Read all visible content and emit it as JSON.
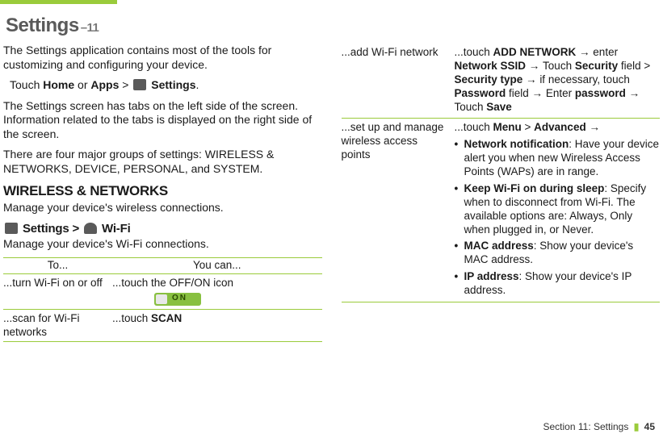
{
  "title_main": "Settings",
  "title_sub": "–11",
  "left": {
    "intro": "The Settings application contains most of the tools for customizing and configuring your device.",
    "touch_line_pre": "Touch ",
    "home": "Home",
    "or": " or ",
    "apps": "Apps",
    "gt": " > ",
    "settings_word": " Settings",
    "period": ".",
    "tabs_info": "The Settings screen has tabs on the left side of the screen. Information related to the tabs is displayed on the right side of the screen.",
    "groups_info": "There are four major groups of settings: WIRELESS & NETWORKS, DEVICE, PERSONAL, and SYSTEM.",
    "wireless_header": "WIRELESS & NETWORKS",
    "wireless_sub": "Manage your device's wireless connections.",
    "wifi_header_pre": " Settings > ",
    "wifi_header_post": " Wi-Fi",
    "wifi_sub": "Manage your device's Wi-Fi connections.",
    "th_to": "To...",
    "th_youcan": "You can...",
    "r1c1": "...turn Wi-Fi on or off",
    "r1c2": "...touch the OFF/ON icon",
    "r2c1": "...scan for Wi-Fi networks",
    "r2c2_pre": "...touch ",
    "r2c2_b": "SCAN"
  },
  "right": {
    "r1c1": "...add Wi-Fi network",
    "r1_pre": "...touch ",
    "add_network": "ADD NETWORK",
    "arrow": " → ",
    "enter": "enter ",
    "network_ssid": "Network SSID",
    "touch": " Touch ",
    "security": "Security",
    "field_gt": " field > ",
    "security_type": "Security type",
    "if_nec": " if necessary, touch ",
    "password": "Password",
    "field_arrow": " field → ",
    "enter2": "Enter ",
    "password2": "password",
    "touch2": " Touch ",
    "save": "Save",
    "r2c1": "...set up and manage wireless access points",
    "r2_pre": "...touch ",
    "menu": "Menu",
    "gt2": " > ",
    "advanced": "Advanced",
    "b1_label": "Network notification",
    "b1_text": ": Have your device alert you when new Wireless Access Points (WAPs) are in range.",
    "b2_label": "Keep Wi-Fi on during sleep",
    "b2_text": ": Specify when to disconnect from Wi-Fi. The available options are: Always, Only when plugged in, or Never.",
    "b3_label": "MAC address",
    "b3_text": ": Show your device's MAC address.",
    "b4_label": "IP address",
    "b4_text": ": Show your device's IP address."
  },
  "footer": {
    "section": "Section 11: Settings",
    "page": "45"
  }
}
